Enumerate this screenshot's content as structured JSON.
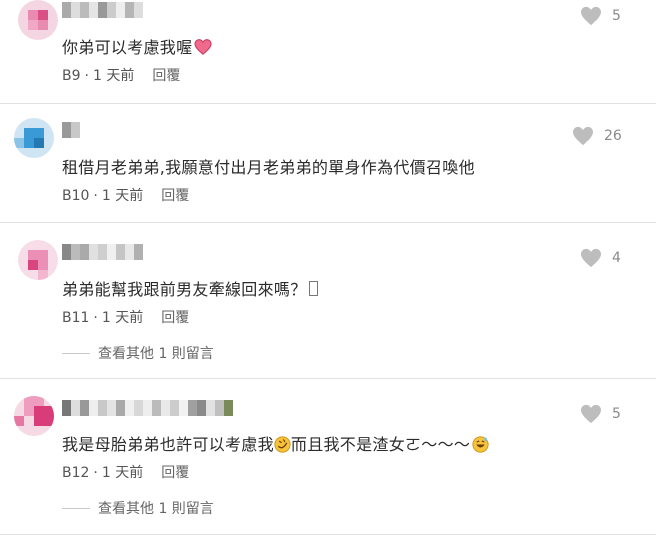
{
  "comments": [
    {
      "text": "你弟可以考慮我喔",
      "emoji": "heart-emoji",
      "floor": "B9",
      "time": "1 天前",
      "reply": "回覆",
      "likes": "5"
    },
    {
      "text": "租借月老弟弟,我願意付出月老弟弟的單身作為代價召喚他",
      "floor": "B10",
      "time": "1 天前",
      "reply": "回覆",
      "likes": "26"
    },
    {
      "text": "弟弟能幫我跟前男友牽線回來嗎？",
      "emoji": "missing-glyph",
      "floor": "B11",
      "time": "1 天前",
      "reply": "回覆",
      "likes": "4",
      "more": "查看其他 1 則留言"
    },
    {
      "text_a": "我是母胎弟弟也許可以考慮我",
      "text_b": "而且我不是渣女ㄛ～～～",
      "emoji_a": "rolling-laughing-emoji",
      "emoji_b": "grinning-sweat-emoji",
      "floor": "B12",
      "time": "1 天前",
      "reply": "回覆",
      "likes": "5",
      "more": "查看其他 1 則留言"
    }
  ],
  "separator": "·",
  "colors": {
    "heart": "#bdbdbd",
    "divider": "#e2e2e2",
    "avatar_pink": "#e35d93",
    "avatar_blue": "#3a9ad6"
  }
}
